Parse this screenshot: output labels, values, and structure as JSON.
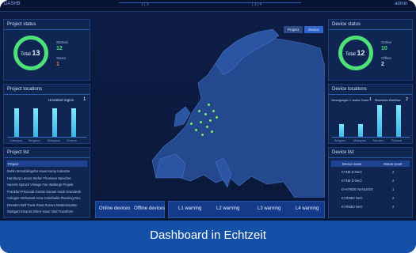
{
  "topbar": {
    "left_label": "DASHB",
    "center_left": "2 | 3",
    "center_right": "| 3 | 4",
    "right_label": "admin"
  },
  "project_status": {
    "title": "Project status",
    "total_label": "Total",
    "total_value": "13",
    "done_label": "Started",
    "done_value": "12",
    "new_label": "Stand",
    "new_value": "1",
    "done_color": "#4fe07a",
    "new_color": "#ff6a4a"
  },
  "project_locations": {
    "title": "Project locations",
    "tag": "Unvisited region",
    "tag_value": "1",
    "categories": [
      "Category",
      "Belgium",
      "Malaysia",
      "Greece"
    ],
    "values": [
      5,
      5,
      5,
      5
    ]
  },
  "project_list": {
    "title": "Project list",
    "header": "Project",
    "rows": [
      "Berlin Immobilingsfar Haus Kamp Industrie",
      "Hamburg Laraus Stefan Thomsen Speicher",
      "Nuernb Sprack Vintage Fan Waltergs Projekt",
      "Frankfurt Pricecab Gerste Sonam Hack Grondevik",
      "Cologne Orthostart Area Colorfaults Planning Rex",
      "Dresden Bell Trunk Roas Kuravu Modernisation",
      "Stuttgart Intranet Mirror Haus Vitel Transform"
    ]
  },
  "map": {
    "buttons": [
      "Project",
      "Device"
    ]
  },
  "bottom": {
    "left_items": [
      "Online devices",
      "Offline devices"
    ],
    "right_items": [
      "L1 warning",
      "L2 warning",
      "L3 warning",
      "L4 warning"
    ]
  },
  "device_status": {
    "title": "Device status",
    "total_label": "Total",
    "total_value": "12",
    "online_label": "Online",
    "online_value": "10",
    "offline_label": "Offline",
    "offline_value": "2",
    "online_color": "#4fe07a"
  },
  "device_locations": {
    "title": "Device locations",
    "tag1": "Versorgungen Y and/or Count",
    "tag1_value": "1",
    "tag2": "Stockholm Workflow",
    "tag2_value": "2",
    "categories": [
      "Belgium",
      "Malaysia",
      "Sweden",
      "Finland"
    ],
    "values": [
      2,
      2,
      5,
      5
    ]
  },
  "device_list": {
    "title": "Device list",
    "col1": "Device name",
    "col2": "Status count",
    "rows": [
      {
        "name": "KYNE D-NeO",
        "count": "2"
      },
      {
        "name": "KYNE D-NeO",
        "count": "2"
      },
      {
        "name": "D-HYNDE NeOLEDS",
        "count": "1"
      },
      {
        "name": "KYRNE0 NeO",
        "count": "2"
      },
      {
        "name": "KYRNE0 NeO",
        "count": "2"
      }
    ]
  },
  "caption": "Dashboard in Echtzeit"
}
